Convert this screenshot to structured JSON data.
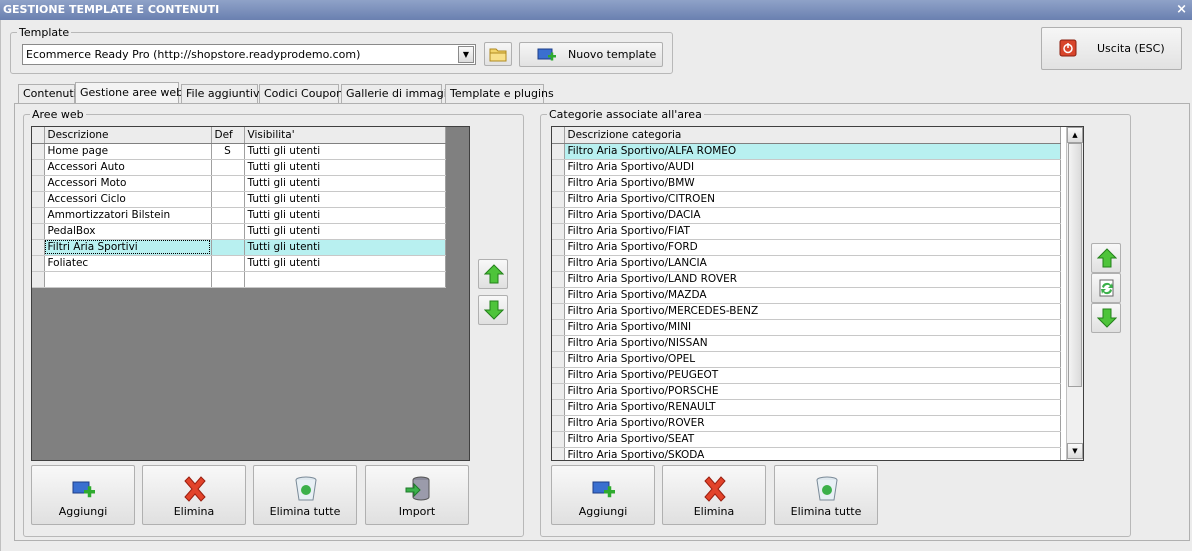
{
  "window": {
    "title": "GESTIONE TEMPLATE E CONTENUTI",
    "close_glyph": "×"
  },
  "template_group": {
    "legend": "Template",
    "selected": "Ecommerce Ready Pro (http://shopstore.readyprodemo.com)",
    "new_button": "Nuovo template"
  },
  "exit_button": "Uscita (ESC)",
  "tabs": [
    {
      "label": "Contenuti",
      "active": false
    },
    {
      "label": "Gestione aree web",
      "active": true
    },
    {
      "label": "File aggiuntivi",
      "active": false
    },
    {
      "label": "Codici Coupon",
      "active": false
    },
    {
      "label": "Gallerie di immagini",
      "active": false
    },
    {
      "label": "Template e plugins",
      "active": false
    }
  ],
  "areas": {
    "legend": "Aree web",
    "columns": [
      "Descrizione",
      "Def",
      "Visibilita'"
    ],
    "rows": [
      {
        "descr": "Home page",
        "def": "S",
        "vis": "Tutti gli utenti"
      },
      {
        "descr": "Accessori Auto",
        "def": "",
        "vis": "Tutti gli utenti"
      },
      {
        "descr": "Accessori Moto",
        "def": "",
        "vis": "Tutti gli utenti"
      },
      {
        "descr": "Accessori Ciclo",
        "def": "",
        "vis": "Tutti gli utenti"
      },
      {
        "descr": "Ammortizzatori Bilstein",
        "def": "",
        "vis": "Tutti gli utenti"
      },
      {
        "descr": "PedalBox",
        "def": "",
        "vis": "Tutti gli utenti"
      },
      {
        "descr": "Filtri Aria Sportivi",
        "def": "",
        "vis": "Tutti gli utenti",
        "selected": true
      },
      {
        "descr": "Foliatec",
        "def": "",
        "vis": "Tutti gli utenti"
      },
      {
        "descr": "",
        "def": "",
        "vis": ""
      }
    ],
    "buttons": {
      "add": "Aggiungi",
      "delete": "Elimina",
      "delete_all": "Elimina tutte",
      "import": "Import"
    }
  },
  "categories": {
    "legend": "Categorie associate all'area",
    "column": "Descrizione categoria",
    "rows": [
      "Filtro Aria Sportivo/ALFA ROMEO",
      "Filtro Aria Sportivo/AUDI",
      "Filtro Aria Sportivo/BMW",
      "Filtro Aria Sportivo/CITROEN",
      "Filtro Aria Sportivo/DACIA",
      "Filtro Aria Sportivo/FIAT",
      "Filtro Aria Sportivo/FORD",
      "Filtro Aria Sportivo/LANCIA",
      "Filtro Aria Sportivo/LAND ROVER",
      "Filtro Aria Sportivo/MAZDA",
      "Filtro Aria Sportivo/MERCEDES-BENZ",
      "Filtro Aria Sportivo/MINI",
      "Filtro Aria Sportivo/NISSAN",
      "Filtro Aria Sportivo/OPEL",
      "Filtro Aria Sportivo/PEUGEOT",
      "Filtro Aria Sportivo/PORSCHE",
      "Filtro Aria Sportivo/RENAULT",
      "Filtro Aria Sportivo/ROVER",
      "Filtro Aria Sportivo/SEAT",
      "Filtro Aria Sportivo/SKODA"
    ],
    "buttons": {
      "add": "Aggiungi",
      "delete": "Elimina",
      "delete_all": "Elimina tutte"
    }
  },
  "colors": {
    "selection": "#b8f0f0",
    "grid_bg": "#808080",
    "title_bar": "#7d90bf"
  }
}
